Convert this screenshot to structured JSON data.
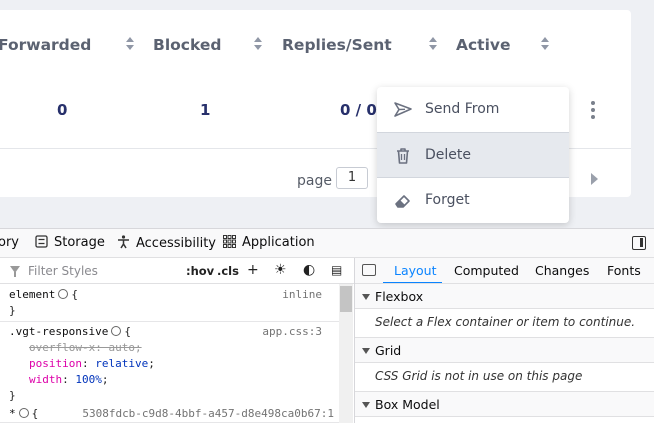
{
  "table": {
    "headers": [
      "Forwarded",
      "Blocked",
      "Replies/Sent",
      "Active"
    ],
    "row": {
      "forwarded": "0",
      "blocked": "1",
      "replies_sent": "0 / 0"
    }
  },
  "pagination": {
    "page_label": "page",
    "page_value": "1"
  },
  "menu": {
    "items": [
      {
        "label": "Send From",
        "icon": "send-icon"
      },
      {
        "label": "Delete",
        "icon": "trash-icon"
      },
      {
        "label": "Forget",
        "icon": "eraser-icon"
      }
    ]
  },
  "devtools": {
    "tabs": [
      "ory",
      "Storage",
      "Accessibility",
      "Application"
    ],
    "rules": {
      "filter_placeholder": "Filter Styles",
      "hov": ":hov",
      "cls": ".cls",
      "r1_selector": "element",
      "r1_source": "inline",
      "r2_selector": ".vgt-responsive",
      "r2_source": "app.css:3",
      "r2_p1": "overflow-x: auto;",
      "r2_p2_name": "position",
      "r2_p2_val": "relative",
      "r2_p3_name": "width",
      "r2_p3_val": "100%",
      "r3_selector": "*",
      "r3_source": "5308fdcb-c9d8-4bbf-a457-d8e498ca0b67:1",
      "open_brace": "{",
      "close_brace": "}"
    },
    "layout": {
      "tabs": [
        "Layout",
        "Computed",
        "Changes",
        "Fonts"
      ],
      "active_tab": "Layout",
      "flexbox_title": "Flexbox",
      "flexbox_msg": "Select a Flex container or item to continue.",
      "grid_title": "Grid",
      "grid_msg": "CSS Grid is not in use on this page",
      "boxmodel_title": "Box Model"
    }
  },
  "colors": {
    "accent": "#0a84ff",
    "value_text": "#27306b",
    "menu_hover": "#e6e9ee"
  }
}
